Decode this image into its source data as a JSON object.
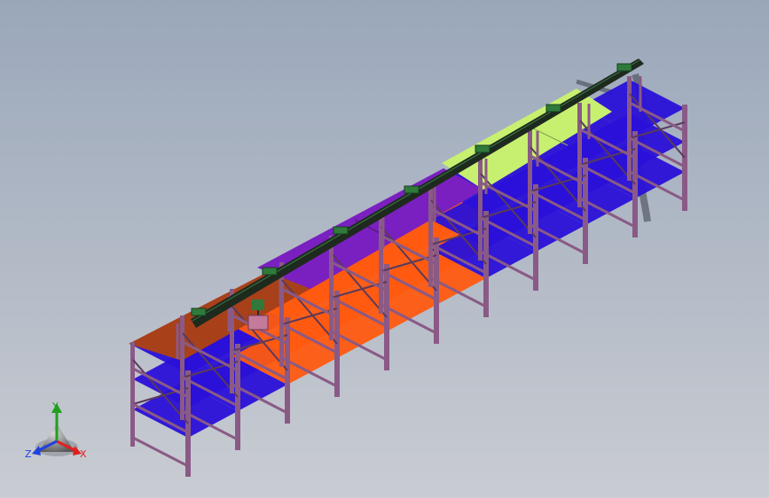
{
  "viewport": {
    "background_top": "#9aa7ba",
    "background_bottom": "#c9ccd2"
  },
  "model": {
    "description_colors": {
      "frame": "#8a5a86",
      "frame_dark": "#5a3a5a",
      "shelf_blue": "#2a10d8",
      "shelf_orange": "#ff5a10",
      "roof_brown": "#a8401a",
      "roof_purple": "#7a20c0",
      "roof_lime": "#c8f070",
      "rail": "#1e2a1e",
      "rail_green": "#2f7a3a",
      "hoist": "#c47a9a"
    }
  },
  "triad": {
    "labels": {
      "x": "X",
      "y": "Y",
      "z": "Z"
    },
    "colors": {
      "x": "#e02020",
      "y": "#20a020",
      "z": "#2040e0"
    }
  }
}
